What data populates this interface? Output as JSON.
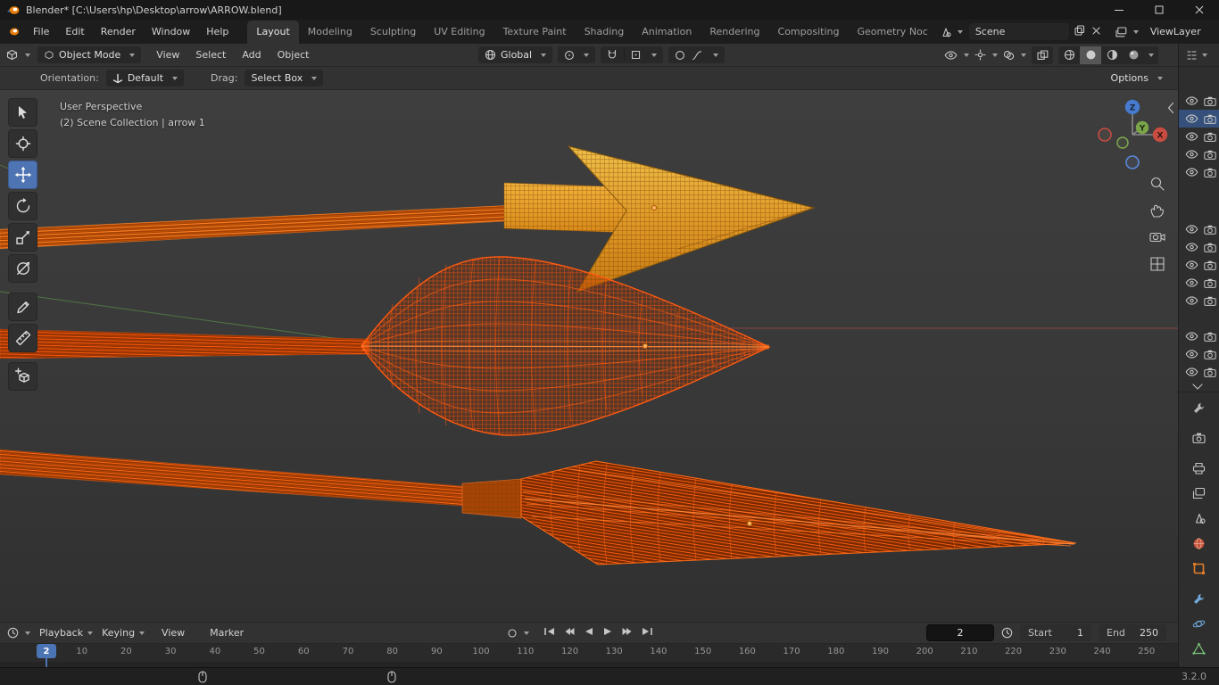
{
  "window": {
    "title": "Blender* [C:\\Users\\hp\\Desktop\\arrow\\ARROW.blend]"
  },
  "topbar": {
    "menus": [
      {
        "label": "File"
      },
      {
        "label": "Edit"
      },
      {
        "label": "Render"
      },
      {
        "label": "Window"
      },
      {
        "label": "Help"
      }
    ],
    "workspaces": [
      {
        "label": "Layout",
        "active": true
      },
      {
        "label": "Modeling"
      },
      {
        "label": "Sculpting"
      },
      {
        "label": "UV Editing"
      },
      {
        "label": "Texture Paint"
      },
      {
        "label": "Shading"
      },
      {
        "label": "Animation"
      },
      {
        "label": "Rendering"
      },
      {
        "label": "Compositing"
      },
      {
        "label": "Geometry Noc"
      }
    ],
    "scene": "Scene",
    "view_layer": "ViewLayer"
  },
  "viewport_header": {
    "mode": "Object Mode",
    "menus": [
      {
        "label": "View"
      },
      {
        "label": "Select"
      },
      {
        "label": "Add"
      },
      {
        "label": "Object"
      }
    ],
    "transform_orientation": "Global"
  },
  "tool_settings": {
    "orientation_label": "Orientation:",
    "orientation_value": "Default",
    "drag_label": "Drag:",
    "drag_value": "Select Box",
    "options": "Options"
  },
  "viewport": {
    "view_label": "User Perspective",
    "context_label": "(2) Scene Collection | arrow 1",
    "axes": {
      "x": "X",
      "y": "Y",
      "z": "Z"
    },
    "selection_color": "#ff6a13",
    "arrowhead_color": "#e9a732",
    "objects": [
      "arrow 1 (flat arrowhead)",
      "arrow 2 (bulb head wireframe)",
      "arrow 3 (cone head wireframe)"
    ]
  },
  "toolbar_tools": [
    "select-box",
    "cursor",
    "move",
    "rotate",
    "scale",
    "transform",
    "annotate",
    "measure",
    "add-cube"
  ],
  "active_tool": "move",
  "outliner": {
    "group1": [
      {
        "active": false
      },
      {
        "active": true
      },
      {
        "active": false
      },
      {
        "active": false
      },
      {
        "active": false
      }
    ],
    "group2": [
      {
        "active": false
      },
      {
        "active": false
      },
      {
        "active": false
      },
      {
        "active": false
      },
      {
        "active": false
      }
    ],
    "group3": [
      {
        "active": false
      },
      {
        "active": false
      },
      {
        "active": false
      }
    ]
  },
  "properties_tabs": [
    "tool",
    "render",
    "output",
    "view-layer",
    "scene",
    "world",
    "object",
    "modifiers",
    "physics",
    "data"
  ],
  "timeline": {
    "playback": "Playback",
    "keying": "Keying",
    "view": "View",
    "marker": "Marker",
    "current_frame": "2",
    "start_label": "Start",
    "start_value": "1",
    "end_label": "End",
    "end_value": "250",
    "ticks": [
      10,
      20,
      30,
      40,
      50,
      60,
      70,
      80,
      90,
      100,
      110,
      120,
      130,
      140,
      150,
      160,
      170,
      180,
      190,
      200,
      210,
      220,
      230,
      240,
      250
    ]
  },
  "statusbar": {
    "version": "3.2.0"
  }
}
